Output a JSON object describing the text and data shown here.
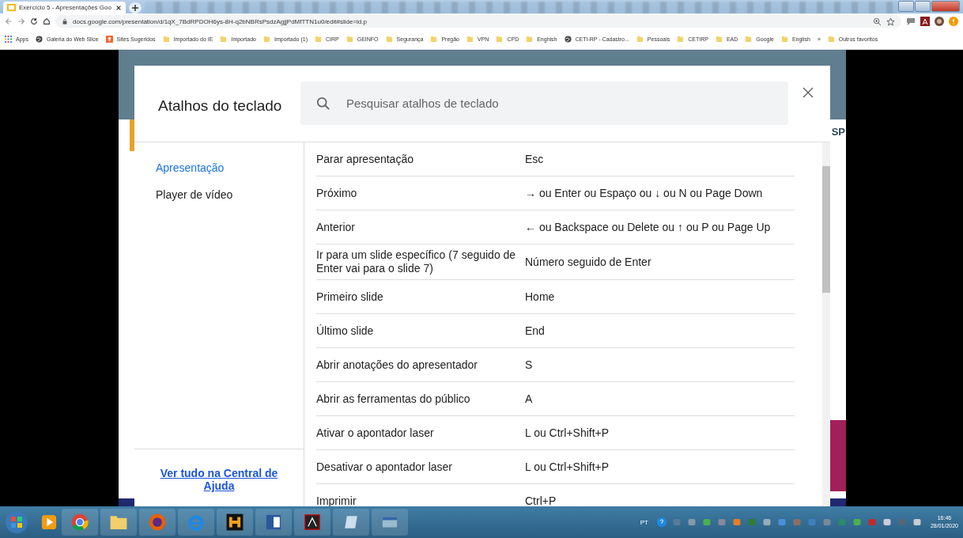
{
  "browser": {
    "tabs": [
      {
        "title": "Exercício 5 - Apresentações Goo",
        "selected": true
      }
    ],
    "address": "docs.google.com/presentation/d/1qX_7BdRPDOH6ys-8H-q2bNBRsPsdzAgjjPdMfTTN1u0/edit#slide=id.p",
    "bookmarks": [
      {
        "label": "Apps",
        "kind": "apps"
      },
      {
        "label": "Galeria do Web Slice",
        "kind": "globe"
      },
      {
        "label": "Sites Sugeridos",
        "kind": "sites"
      },
      {
        "label": "Importado do IE",
        "kind": "folder"
      },
      {
        "label": "Importado",
        "kind": "folder"
      },
      {
        "label": "Importado (1)",
        "kind": "folder"
      },
      {
        "label": "CIRP",
        "kind": "folder"
      },
      {
        "label": "GEINFO",
        "kind": "folder"
      },
      {
        "label": "Segurança",
        "kind": "folder"
      },
      {
        "label": "Pregão",
        "kind": "folder"
      },
      {
        "label": "VPN",
        "kind": "folder"
      },
      {
        "label": "CPD",
        "kind": "folder"
      },
      {
        "label": "Enghish",
        "kind": "folder"
      },
      {
        "label": "CETI-RP - Cadastro...",
        "kind": "globe"
      },
      {
        "label": "Pessoais",
        "kind": "folder"
      },
      {
        "label": "CETIRP",
        "kind": "folder"
      },
      {
        "label": "EAD",
        "kind": "folder"
      },
      {
        "label": "Google",
        "kind": "folder"
      },
      {
        "label": "English",
        "kind": "folder"
      }
    ],
    "more": "»",
    "other_bookmarks": "Outros favoritos"
  },
  "slide_text_fragment": "SP",
  "dialog": {
    "title": "Atalhos do teclado",
    "search": {
      "placeholder": "Pesquisar atalhos de teclado"
    },
    "categories": [
      {
        "label": "Apresentação",
        "selected": true
      },
      {
        "label": "Player de vídeo",
        "selected": false
      }
    ],
    "help_link": "Ver tudo na Central de Ajuda",
    "shortcuts": [
      {
        "action": "Parar apresentação",
        "keys": "Esc"
      },
      {
        "action": "Próximo",
        "keys": "→ ou Enter ou Espaço ou ↓ ou N ou Page Down"
      },
      {
        "action": "Anterior",
        "keys": "← ou Backspace ou Delete ou ↑ ou P ou Page Up"
      },
      {
        "action": "Ir para um slide específico (7 seguido de Enter vai para o slide 7)",
        "keys": "Número seguido de Enter"
      },
      {
        "action": "Primeiro slide",
        "keys": "Home"
      },
      {
        "action": "Último slide",
        "keys": "End"
      },
      {
        "action": "Abrir anotações do apresentador",
        "keys": "S"
      },
      {
        "action": "Abrir as ferramentas do público",
        "keys": "A"
      },
      {
        "action": "Ativar o apontador laser",
        "keys": "L ou Ctrl+Shift+P"
      },
      {
        "action": "Desativar o apontador laser",
        "keys": "L ou Ctrl+Shift+P"
      },
      {
        "action": "Imprimir",
        "keys": "Ctrl+P"
      }
    ]
  },
  "taskbar": {
    "language": "PT",
    "time": "16:46",
    "date": "28/01/2020"
  }
}
